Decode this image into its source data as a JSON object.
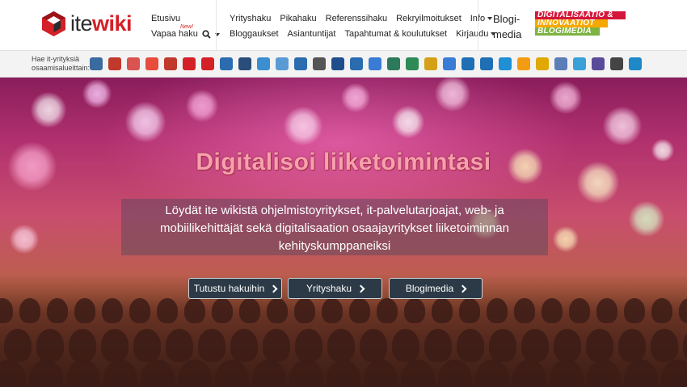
{
  "logo": {
    "part1": "ite",
    "part2": "wiki"
  },
  "nav": {
    "col1": {
      "etusivu": "Etusivu",
      "vapaa_haku": "Vapaa haku",
      "new_tag": "New!"
    },
    "row1": [
      "Yrityshaku",
      "Pikahaku",
      "Referenssihaku",
      "Rekryilmoitukset",
      "Info"
    ],
    "row2": [
      "Bloggaukset",
      "Asiantuntijat",
      "Tapahtumat & koulutukset",
      "Kirjaudu"
    ],
    "blogi": "Blogi-media"
  },
  "promo": {
    "line1": "DIGITALISAATIO &",
    "line2": "INNOVAATIOT",
    "line3": "BLOGIMEDIA"
  },
  "categories": {
    "label": "Hae it-yrityksiä osaamisalueittain:",
    "icons": [
      "ERP",
      "CRM",
      "HELP",
      "MOB",
      "DEV",
      "HR",
      "TGT",
      "DOC",
      "DB",
      "WEB",
      "CLD",
      "SHOP",
      "CODE",
      "ID",
      "NET",
      "SRC",
      "USR",
      "MAP",
      "IOT",
      "WIN",
      "SAP",
      "IBM",
      "SF",
      "AWS",
      "JAVA",
      "PHP",
      "REACT",
      ".NET",
      "WP",
      "DRP"
    ]
  },
  "hero": {
    "title": "Digitalisoi liiketoimintasi",
    "text": "Löydät ite wikistä ohjelmistoyritykset, it-palvelutarjoajat, web- ja mobiilikehittäjät sekä digitalisaation osaajayritykset liiketoiminnan kehityskumppaneiksi",
    "buttons": [
      "Tutustu hakuihin",
      "Yrityshaku",
      "Blogimedia"
    ]
  },
  "colors": {
    "brand_red": "#d42027",
    "button_bg": "#2b3a46",
    "title_pink": "#f7a0ad"
  }
}
